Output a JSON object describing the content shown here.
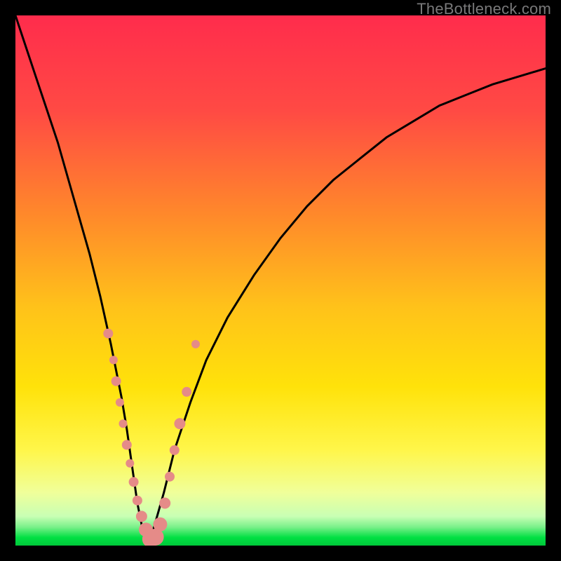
{
  "watermark": "TheBottleneck.com",
  "colors": {
    "frame": "#000000",
    "gradient_top": "#ff2c4c",
    "gradient_upper_mid": "#ff8a2a",
    "gradient_mid": "#ffd400",
    "gradient_low": "#fff266",
    "gradient_pale": "#f7ffb0",
    "gradient_green": "#00e043",
    "curve_stroke": "#000000",
    "marker_fill": "#e58b88"
  },
  "chart_data": {
    "type": "line",
    "title": "",
    "xlabel": "",
    "ylabel": "",
    "xlim": [
      0,
      100
    ],
    "ylim": [
      0,
      100
    ],
    "series": [
      {
        "name": "bottleneck-curve",
        "x": [
          0,
          2,
          4,
          6,
          8,
          10,
          12,
          14,
          16,
          18,
          20,
          21,
          22,
          23,
          24,
          25,
          26,
          28,
          30,
          33,
          36,
          40,
          45,
          50,
          55,
          60,
          65,
          70,
          75,
          80,
          85,
          90,
          95,
          100
        ],
        "values": [
          100,
          94,
          88,
          82,
          76,
          69,
          62,
          55,
          47,
          38,
          28,
          22,
          15,
          8,
          3,
          0,
          3,
          10,
          18,
          27,
          35,
          43,
          51,
          58,
          64,
          69,
          73,
          77,
          80,
          83,
          85,
          87,
          88.5,
          90
        ]
      }
    ],
    "markers": {
      "name": "highlight-points",
      "x": [
        17.5,
        18.5,
        19,
        19.7,
        20.3,
        21,
        21.6,
        22.3,
        23,
        23.8,
        24.6,
        25.5,
        26.4,
        27.3,
        28.2,
        29.1,
        30,
        31,
        32.3,
        34
      ],
      "values": [
        40,
        35,
        31,
        27,
        23,
        19,
        15.5,
        12,
        8.5,
        5.5,
        3,
        1.2,
        1.6,
        4,
        8,
        13,
        18,
        23,
        29,
        38
      ],
      "r": [
        7,
        6,
        7,
        6,
        6,
        7,
        6,
        7,
        7,
        8,
        10,
        12,
        12,
        10,
        8,
        7,
        7,
        8,
        7,
        6
      ]
    }
  }
}
